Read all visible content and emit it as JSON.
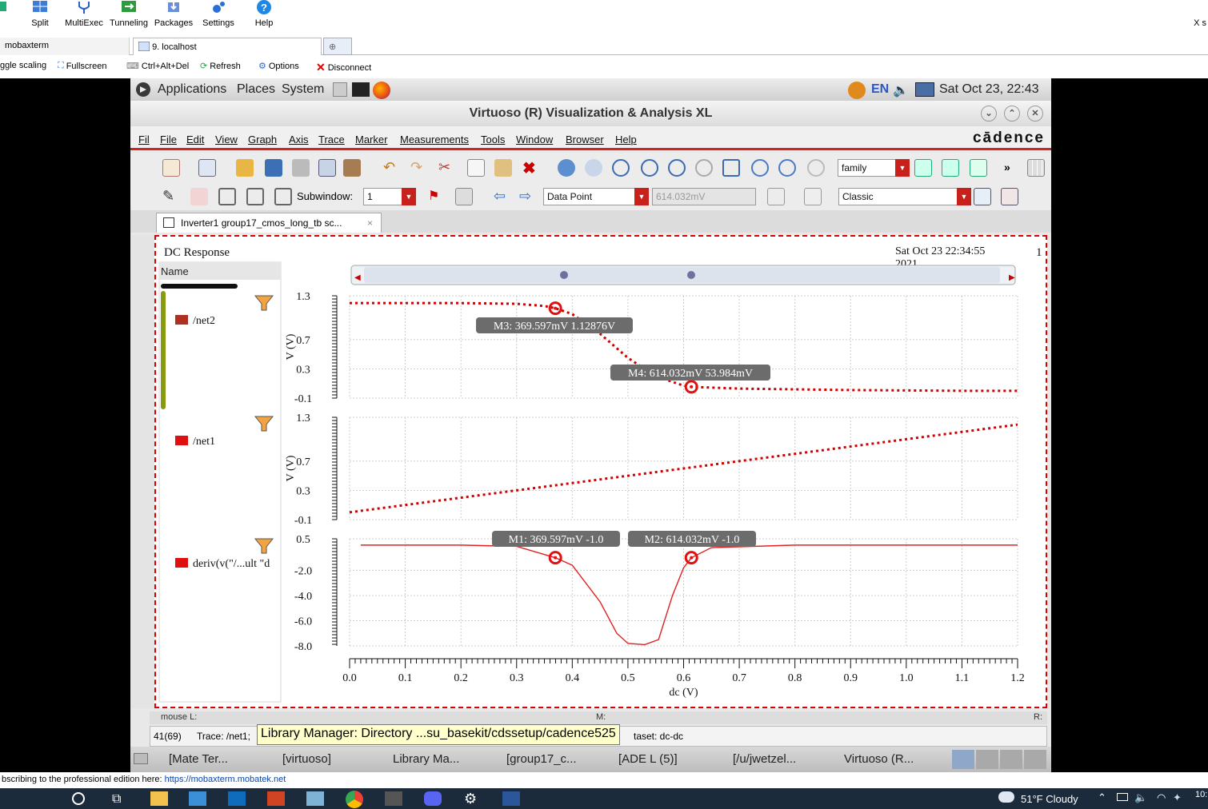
{
  "mobaxterm": {
    "toolbar": [
      {
        "label": "Split",
        "icon": "split-icon"
      },
      {
        "label": "MultiExec",
        "icon": "multiexec-icon"
      },
      {
        "label": "Tunneling",
        "icon": "tunneling-icon"
      },
      {
        "label": "Packages",
        "icon": "packages-icon"
      },
      {
        "label": "Settings",
        "icon": "settings-icon"
      },
      {
        "label": "Help",
        "icon": "help-icon"
      }
    ],
    "right_edge_text": "X s",
    "tabs": [
      {
        "label": "mobaxterm"
      },
      {
        "label": "9. localhost"
      }
    ],
    "subtoolbar": [
      {
        "label": "ggle scaling"
      },
      {
        "label": "Fullscreen"
      },
      {
        "label": "Ctrl+Alt+Del"
      },
      {
        "label": "Refresh"
      },
      {
        "label": "Options"
      },
      {
        "label": "Disconnect"
      }
    ],
    "promo_text": "bscribing to the professional edition here: ",
    "promo_link": "https://mobaxterm.mobatek.net"
  },
  "gnome": {
    "menus": [
      "Applications",
      "Places",
      "System"
    ],
    "lang": "EN",
    "clock": "Sat Oct 23, 22:43"
  },
  "window": {
    "title": "Virtuoso (R) Visualization & Analysis XL",
    "brand": "cādence",
    "menus": [
      "File",
      "Edit",
      "View",
      "Graph",
      "Axis",
      "Trace",
      "Marker",
      "Measurements",
      "Tools",
      "Window",
      "Browser",
      "Help"
    ],
    "left_cut_menu": "Fil",
    "family_combo": "family",
    "subwindow_label": "Subwindow:",
    "subwindow_value": "1",
    "marker_type": "Data Point",
    "marker_value": "614.032mV",
    "style_combo": "Classic",
    "doc_tab": "Inverter1 group17_cmos_long_tb sc..."
  },
  "plot": {
    "title": "DC Response",
    "timestamp": "Sat Oct 23 22:34:55",
    "timestamp_line2": "2021",
    "right_edge_text": "1",
    "legend_header": "Name",
    "traces": [
      "/net2",
      "/net1",
      "deriv(v(\"/...ult \"d"
    ],
    "markers": [
      "M3: 369.597mV 1.12876V",
      "M4: 614.032mV 53.984mV",
      "M1: 369.597mV -1.0",
      "M2: 614.032mV -1.0"
    ],
    "y_labels": [
      "V (V)",
      "V (V)"
    ],
    "y_ticks_top": [
      "1.3",
      "0.7",
      "0.3",
      "-0.1"
    ],
    "y_ticks_mid": [
      "1.3",
      "0.7",
      "0.3",
      "-0.1"
    ],
    "y_ticks_bottom": [
      "0.5",
      "-2.0",
      "-4.0",
      "-6.0",
      "-8.0"
    ],
    "x_ticks": [
      "0.0",
      "0.1",
      "0.2",
      "0.3",
      "0.4",
      "0.5",
      "0.6",
      "0.7",
      "0.8",
      "0.9",
      "1.0",
      "1.1",
      "1.2"
    ],
    "xlabel": "dc (V)"
  },
  "chart_data": {
    "type": "line",
    "xlabel": "dc (V)",
    "xlim": [
      0.0,
      1.2
    ],
    "subplots": [
      {
        "ylabel": "V (V)",
        "ylim": [
          -0.1,
          1.3
        ],
        "series": [
          {
            "name": "/net2",
            "style": "dotted",
            "color": "#d00000",
            "x": [
              0.0,
              0.1,
              0.2,
              0.3,
              0.35,
              0.3696,
              0.4,
              0.45,
              0.5,
              0.55,
              0.6,
              0.614,
              0.7,
              0.8,
              0.9,
              1.0,
              1.1,
              1.2
            ],
            "y": [
              1.2,
              1.2,
              1.2,
              1.19,
              1.16,
              1.129,
              1.05,
              0.78,
              0.45,
              0.2,
              0.07,
              0.054,
              0.03,
              0.02,
              0.01,
              0.005,
              0.0,
              0.0
            ]
          }
        ]
      },
      {
        "ylabel": "V (V)",
        "ylim": [
          -0.1,
          1.3
        ],
        "series": [
          {
            "name": "/net1",
            "style": "dotted",
            "color": "#d00000",
            "x": [
              0.0,
              0.2,
              0.4,
              0.6,
              0.8,
              1.0,
              1.2
            ],
            "y": [
              0.0,
              0.2,
              0.4,
              0.6,
              0.8,
              1.0,
              1.2
            ]
          }
        ]
      },
      {
        "ylabel": "",
        "ylim": [
          -8.0,
          0.5
        ],
        "series": [
          {
            "name": "deriv(v(\"/...ult \"d",
            "style": "solid",
            "color": "#e02020",
            "x": [
              0.02,
              0.2,
              0.3,
              0.3696,
              0.4,
              0.45,
              0.48,
              0.5,
              0.53,
              0.555,
              0.58,
              0.6,
              0.614,
              0.65,
              0.8,
              1.0,
              1.2
            ],
            "y": [
              0.0,
              0.0,
              -0.1,
              -1.0,
              -1.6,
              -4.5,
              -7.0,
              -7.8,
              -7.9,
              -7.5,
              -4.0,
              -1.8,
              -1.0,
              -0.2,
              0.0,
              0.0,
              0.0
            ]
          }
        ]
      }
    ]
  },
  "status": {
    "mouse": "mouse L:",
    "middle": "M:",
    "right": "R:",
    "count": "41(69)",
    "trace": "Trace: /net1;",
    "dataset": "taset: dc-dc",
    "tooltip": "Library Manager: Directory ...su_basekit/cdssetup/cadence525"
  },
  "taskbar": [
    {
      "label": "[Mate Ter..."
    },
    {
      "label": "[virtuoso]"
    },
    {
      "label": "Library Ma..."
    },
    {
      "label": "[group17_c..."
    },
    {
      "label": "[ADE L (5)]"
    },
    {
      "label": "[/u/jwetzel..."
    },
    {
      "label": "Virtuoso (R..."
    }
  ],
  "windows": {
    "weather": "51°F  Cloudy",
    "time": "10:"
  },
  "colors": {
    "accent": "#d0261d",
    "trace": "#d00000"
  }
}
